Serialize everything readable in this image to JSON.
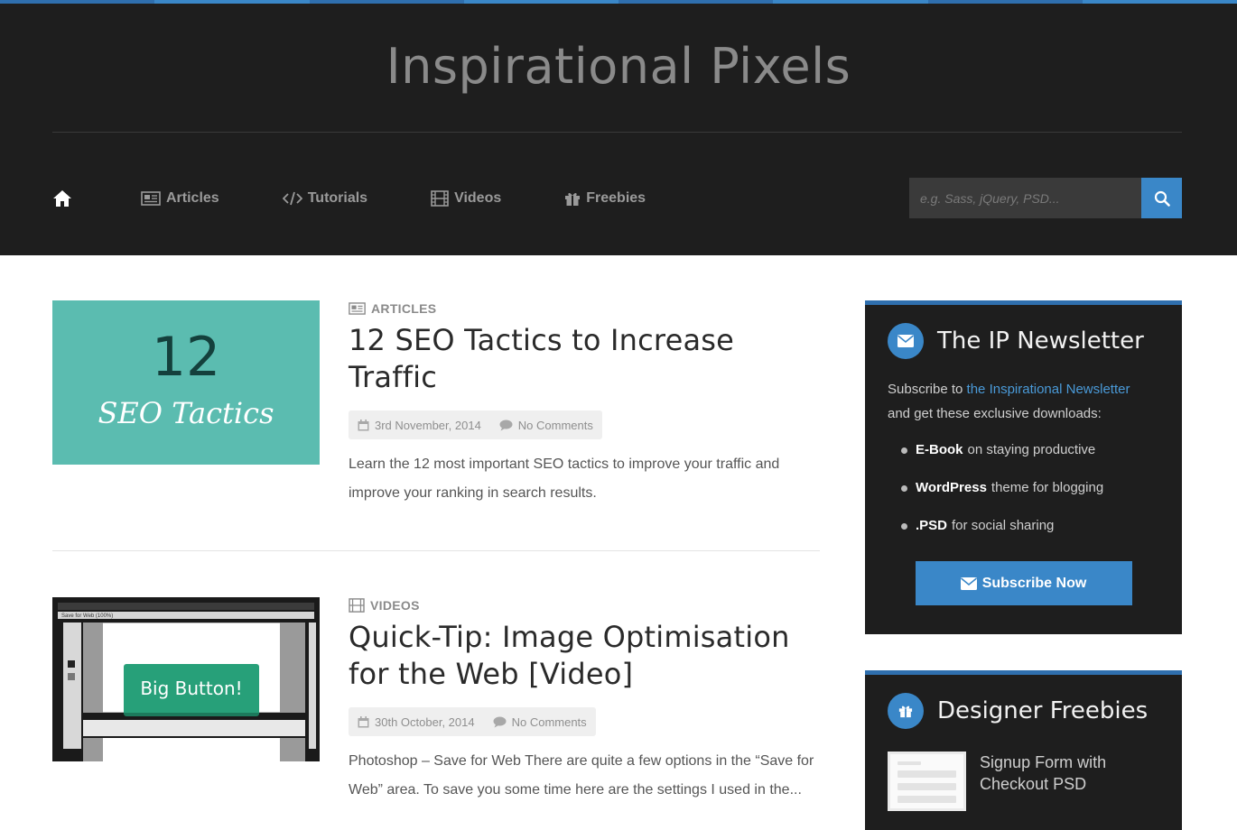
{
  "site": {
    "brand": "Inspirational Pixels",
    "colors": {
      "header_bg": "#1e1e1e",
      "accent": "#3a87c8",
      "stripe": "#2f6fae"
    }
  },
  "nav": {
    "home_icon": "home-icon",
    "items": [
      {
        "label": "Articles",
        "icon": "newspaper-icon"
      },
      {
        "label": "Tutorials",
        "icon": "code-icon"
      },
      {
        "label": "Videos",
        "icon": "film-icon"
      },
      {
        "label": "Freebies",
        "icon": "gift-icon"
      }
    ]
  },
  "search": {
    "placeholder": "e.g. Sass, jQuery, PSD...",
    "icon": "search-icon"
  },
  "posts": [
    {
      "category": "ARTICLES",
      "title": "12 SEO Tactics to Increase Traffic",
      "date": "3rd November, 2014",
      "comments": "No Comments",
      "excerpt": "Learn the 12 most important SEO tactics to improve your traffic and improve your ranking in search results.",
      "thumb": {
        "number": "12",
        "caption": "SEO Tactics",
        "bg": "#5bbcb0"
      }
    },
    {
      "category": "VIDEOS",
      "title": "Quick-Tip: Image Optimisation for the Web [Video]",
      "date": "30th October, 2014",
      "comments": "No Comments",
      "excerpt": "Photoshop – Save for Web There are quite a few options in the “Save for Web” area. To save you some time here are the settings I used in the...",
      "thumb": {
        "button_label": "Big Button!",
        "window_title": "Save for Web (100%)"
      }
    }
  ],
  "sidebar": {
    "newsletter": {
      "title": "The IP Newsletter",
      "icon": "envelope-icon",
      "text_before": "Subscribe to ",
      "link": "the Inspirational Newsletter",
      "text_after": "and get these exclusive downloads:",
      "items": [
        {
          "bold": "E-Book",
          "rest": "on staying productive"
        },
        {
          "bold": "WordPress",
          "rest": "theme for blogging"
        },
        {
          "bold": ".PSD",
          "rest": "for social sharing"
        }
      ],
      "button": "Subscribe Now"
    },
    "freebies": {
      "title": "Designer Freebies",
      "icon": "gift-icon",
      "items": [
        {
          "title": "Signup Form with Checkout PSD"
        }
      ]
    }
  }
}
